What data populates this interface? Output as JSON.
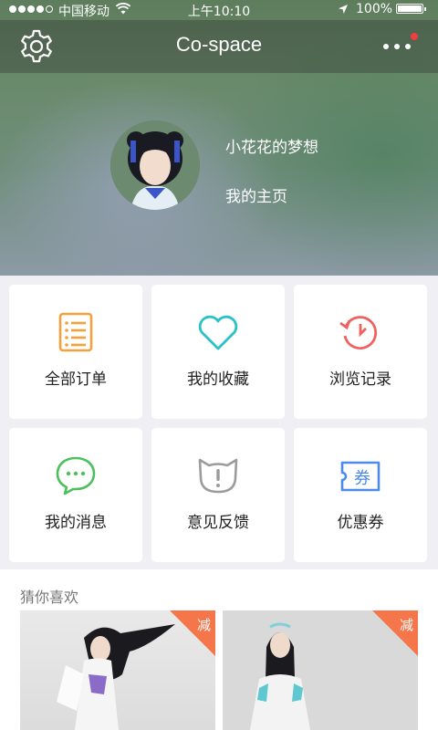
{
  "status_bar": {
    "carrier": "中国移动",
    "time": "上午10:10",
    "battery": "100%",
    "battery_level": 1.0
  },
  "nav": {
    "title": "Co-space",
    "settings_icon": "gear-icon",
    "more_icon": "more-dots-icon",
    "notification_dot_color": "#f03e3e"
  },
  "profile": {
    "name": "小花花的梦想",
    "home_link": "我的主页"
  },
  "menu": [
    {
      "label": "全部订单",
      "icon": "order-list-icon",
      "color": "#f5a03a"
    },
    {
      "label": "我的收藏",
      "icon": "heart-icon",
      "color": "#27c2c7"
    },
    {
      "label": "浏览记录",
      "icon": "history-icon",
      "color": "#f0605e"
    },
    {
      "label": "我的消息",
      "icon": "message-icon",
      "color": "#4cc05c"
    },
    {
      "label": "意见反馈",
      "icon": "feedback-cat-icon",
      "color": "#9b9b9b"
    },
    {
      "label": "优惠券",
      "icon": "coupon-icon",
      "color": "#4c8be8"
    }
  ],
  "recommend": {
    "title": "猜你喜欢",
    "items": [
      {
        "badge": "减"
      },
      {
        "badge": "减"
      }
    ]
  }
}
